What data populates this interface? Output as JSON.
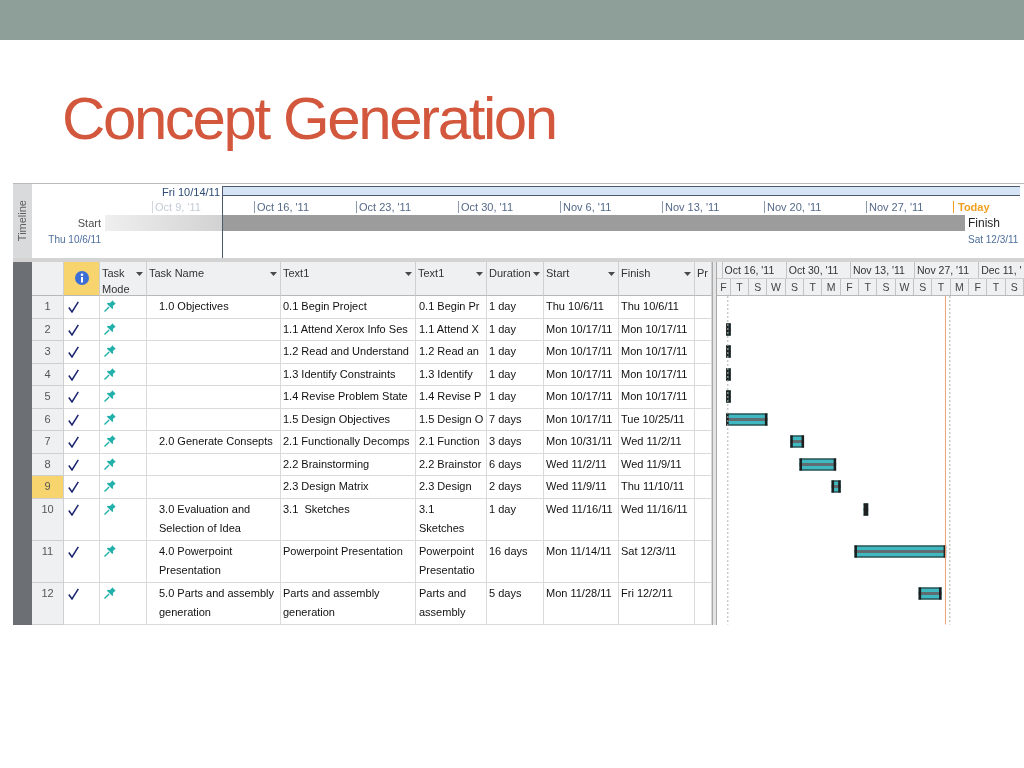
{
  "slide": {
    "title": "Concept Generation"
  },
  "timeline": {
    "panel_label": "Timeline",
    "view_start_date": "Fri 10/14/11",
    "ticks": [
      {
        "label": "Oct 9, '11",
        "in_view": false
      },
      {
        "label": "Oct 16, '11",
        "in_view": true
      },
      {
        "label": "Oct 23, '11",
        "in_view": true
      },
      {
        "label": "Oct 30, '11",
        "in_view": true
      },
      {
        "label": "Nov 6, '11",
        "in_view": true
      },
      {
        "label": "Nov 13, '11",
        "in_view": true
      },
      {
        "label": "Nov 20, '11",
        "in_view": true
      },
      {
        "label": "Nov 27, '11",
        "in_view": true
      }
    ],
    "today_label": "Today",
    "start": {
      "label": "Start",
      "date": "Thu 10/6/11"
    },
    "finish": {
      "label": "Finish",
      "date": "Sat 12/3/11"
    }
  },
  "table": {
    "columns": [
      {
        "kind": "indicators",
        "selected": true
      },
      {
        "kind": "field",
        "label": "Task Mode",
        "dropdown": true,
        "selected": false
      },
      {
        "kind": "field",
        "label": "Task Name",
        "dropdown": true,
        "selected": false
      },
      {
        "kind": "field",
        "label": "Text1",
        "dropdown": true,
        "selected": false
      },
      {
        "kind": "field",
        "label": "Text1",
        "dropdown": true,
        "selected": false
      },
      {
        "kind": "field",
        "label": "Duration",
        "dropdown": true,
        "selected": false
      },
      {
        "kind": "field",
        "label": "Start",
        "dropdown": true,
        "selected": false
      },
      {
        "kind": "field",
        "label": "Finish",
        "dropdown": true,
        "selected": false
      },
      {
        "kind": "field",
        "label": "Pr",
        "dropdown": false,
        "selected": false
      }
    ],
    "rows": [
      {
        "number": "1",
        "selected": false,
        "complete": true,
        "kind": "manual",
        "task_name": "1.0 Objectives",
        "text1": "0.1 Begin Project",
        "text1_copy": "0.1 Begin Pr",
        "duration": "1 day",
        "start": "Thu 10/6/11",
        "finish": "Thu 10/6/11"
      },
      {
        "number": "2",
        "selected": false,
        "complete": true,
        "kind": "manual",
        "text1": "1.1 Attend Xerox Info Ses",
        "text1_copy": "1.1 Attend X",
        "duration": "1 day",
        "start": "Mon 10/17/11",
        "finish": "Mon 10/17/11"
      },
      {
        "number": "3",
        "selected": false,
        "complete": true,
        "kind": "manual",
        "text1": "1.2 Read and Understand",
        "text1_copy": "1.2 Read an",
        "duration": "1 day",
        "start": "Mon 10/17/11",
        "finish": "Mon 10/17/11"
      },
      {
        "number": "4",
        "selected": false,
        "complete": true,
        "kind": "manual",
        "text1": "1.3 Identify Constraints",
        "text1_copy": "1.3 Identify",
        "duration": "1 day",
        "start": "Mon 10/17/11",
        "finish": "Mon 10/17/11"
      },
      {
        "number": "5",
        "selected": false,
        "complete": true,
        "kind": "manual",
        "text1": "1.4 Revise Problem State",
        "text1_copy": "1.4 Revise P",
        "duration": "1 day",
        "start": "Mon 10/17/11",
        "finish": "Mon 10/17/11"
      },
      {
        "number": "6",
        "selected": false,
        "complete": true,
        "kind": "manual",
        "text1": "1.5 Design Objectives",
        "text1_copy": "1.5 Design O",
        "duration": "7 days",
        "start": "Mon 10/17/11",
        "finish": "Tue 10/25/11"
      },
      {
        "number": "7",
        "selected": false,
        "complete": true,
        "kind": "manual",
        "task_name": "2.0 Generate Consepts",
        "text1": "2.1 Functionally Decomps",
        "text1_copy": "2.1 Function",
        "duration": "3 days",
        "start": "Mon 10/31/11",
        "finish": "Wed 11/2/11"
      },
      {
        "number": "8",
        "selected": false,
        "complete": true,
        "kind": "manual",
        "text1": "2.2 Brainstorming",
        "text1_copy": "2.2 Brainstor",
        "duration": "6 days",
        "start": "Wed 11/2/11",
        "finish": "Wed 11/9/11"
      },
      {
        "number": "9",
        "selected": true,
        "complete": true,
        "kind": "manual",
        "text1": "2.3 Design Matrix",
        "text1_copy": "2.3 Design",
        "duration": "2 days",
        "start": "Wed 11/9/11",
        "finish": "Thu 11/10/11"
      },
      {
        "number": "10",
        "selected": false,
        "complete": true,
        "kind": "manual",
        "task_name": "3.0 Evaluation and Selection of Idea",
        "text1": "3.1  Sketches",
        "text1_copy": "3.1  Sketches",
        "duration": "1 day",
        "start": "Wed 11/16/11",
        "finish": "Wed 11/16/11"
      },
      {
        "number": "11",
        "selected": false,
        "complete": true,
        "kind": "manual",
        "task_name": "4.0 Powerpoint Presentation",
        "text1": "Powerpoint Presentation",
        "text1_copy": "Powerpoint Presentatio",
        "duration": "16 days",
        "start": "Mon 11/14/11",
        "finish": "Sat 12/3/11"
      },
      {
        "number": "12",
        "selected": false,
        "complete": true,
        "kind": "manual",
        "task_name": "5.0 Parts and assembly generation",
        "text1": "Parts and assembly generation",
        "text1_copy": "Parts and assembly",
        "duration": "5 days",
        "start": "Mon 11/28/11",
        "finish": "Fri 12/2/11"
      }
    ]
  },
  "gantt": {
    "timescale_top": [
      "Oct 16, '11",
      "Oct 30, '11",
      "Nov 13, '11",
      "Nov 27, '11",
      "Dec 11, '"
    ],
    "day_labels": [
      "F",
      "T",
      "S",
      "W",
      "S",
      "T",
      "M",
      "F",
      "T",
      "S",
      "W",
      "S",
      "T",
      "M",
      "F",
      "T",
      "S"
    ]
  }
}
